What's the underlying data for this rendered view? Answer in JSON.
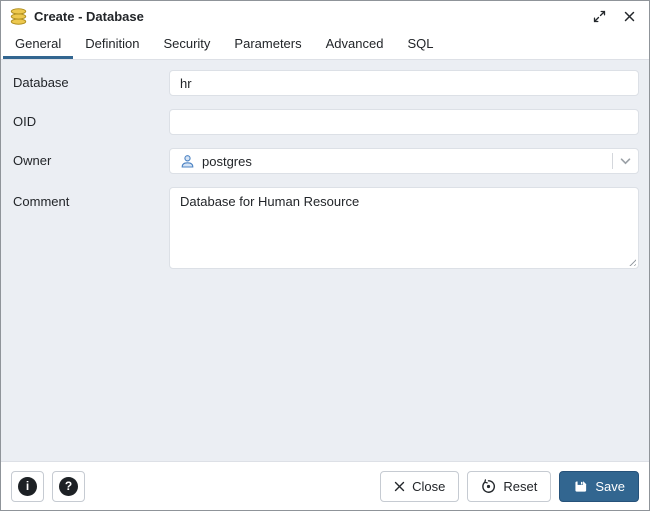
{
  "window": {
    "title": "Create - Database"
  },
  "tabs": [
    {
      "label": "General",
      "active": true
    },
    {
      "label": "Definition",
      "active": false
    },
    {
      "label": "Security",
      "active": false
    },
    {
      "label": "Parameters",
      "active": false
    },
    {
      "label": "Advanced",
      "active": false
    },
    {
      "label": "SQL",
      "active": false
    }
  ],
  "form": {
    "fields": [
      {
        "label": "Database",
        "type": "text",
        "value": "hr"
      },
      {
        "label": "OID",
        "type": "text",
        "value": ""
      },
      {
        "label": "Owner",
        "type": "select",
        "value": "postgres",
        "icon": "user-icon"
      },
      {
        "label": "Comment",
        "type": "textarea",
        "value": "Database for Human Resource"
      }
    ]
  },
  "footer": {
    "info_glyph": "i",
    "help_glyph": "?",
    "close_label": "Close",
    "reset_label": "Reset",
    "save_label": "Save"
  },
  "colors": {
    "accent": "#326690",
    "form_background": "#ebeef3",
    "database_icon_gold": "#edc84e",
    "owner_icon_blue": "#4c83c3"
  }
}
